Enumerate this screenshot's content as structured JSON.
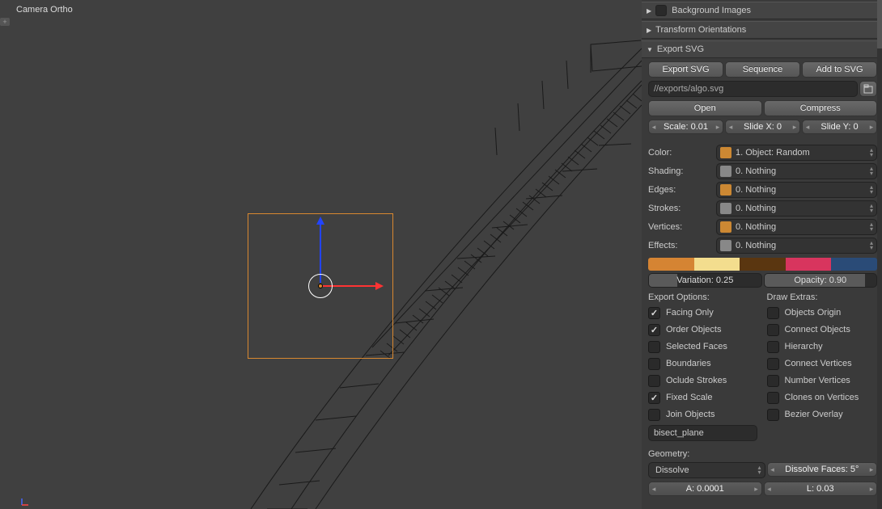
{
  "viewport": {
    "label": "Camera Ortho"
  },
  "sections": {
    "background_images": {
      "label": "Background Images",
      "expanded": false,
      "checkbox": true
    },
    "transform_orientations": {
      "label": "Transform Orientations",
      "expanded": false,
      "checkbox": false
    },
    "export_svg": {
      "label": "Export SVG",
      "expanded": true,
      "checkbox": false
    }
  },
  "export": {
    "btn_export": "Export SVG",
    "btn_sequence": "Sequence",
    "btn_add": "Add to SVG",
    "path": "//exports/algo.svg",
    "btn_open": "Open",
    "btn_compress": "Compress",
    "scale": "Scale: 0.01",
    "slide_x": "Slide X: 0",
    "slide_y": "Slide Y: 0",
    "props": {
      "color": {
        "label": "Color:",
        "value": "1. Object: Random",
        "icon": "obj"
      },
      "shading": {
        "label": "Shading:",
        "value": "0. Nothing",
        "icon": "grey"
      },
      "edges": {
        "label": "Edges:",
        "value": "0. Nothing",
        "icon": "obj"
      },
      "strokes": {
        "label": "Strokes:",
        "value": "0. Nothing",
        "icon": "grey"
      },
      "vertices": {
        "label": "Vertices:",
        "value": "0. Nothing",
        "icon": "obj"
      },
      "effects": {
        "label": "Effects:",
        "value": "0. Nothing",
        "icon": "grey"
      }
    },
    "palette": [
      "#d58433",
      "#f3dd8e",
      "#5a3610",
      "#d8355e",
      "#2a4b77"
    ],
    "variation": {
      "label": "Variation: 0.25",
      "fill": 25
    },
    "opacity": {
      "label": "Opacity: 0.90",
      "fill": 90
    },
    "options_head": "Export Options:",
    "extras_head": "Draw Extras:",
    "options": [
      {
        "label": "Facing Only",
        "checked": true
      },
      {
        "label": "Order Objects",
        "checked": true
      },
      {
        "label": "Selected Faces",
        "checked": false
      },
      {
        "label": "Boundaries",
        "checked": false
      },
      {
        "label": "Oclude Strokes",
        "checked": false
      },
      {
        "label": "Fixed Scale",
        "checked": true
      },
      {
        "label": "Join Objects",
        "checked": false
      }
    ],
    "extras": [
      {
        "label": "Objects Origin",
        "checked": false
      },
      {
        "label": "Connect Objects",
        "checked": false
      },
      {
        "label": "Hierarchy",
        "checked": false
      },
      {
        "label": "Connect Vertices",
        "checked": false
      },
      {
        "label": "Number Vertices",
        "checked": false
      },
      {
        "label": "Clones on Vertices",
        "checked": false
      },
      {
        "label": "Bezier Overlay",
        "checked": false
      }
    ],
    "bisect_input": "bisect_plane",
    "geometry_head": "Geometry:",
    "geometry_mode": "Dissolve",
    "dissolve_faces": "Dissolve Faces: 5°",
    "a_val": "A: 0.0001",
    "l_val": "L: 0.03"
  }
}
